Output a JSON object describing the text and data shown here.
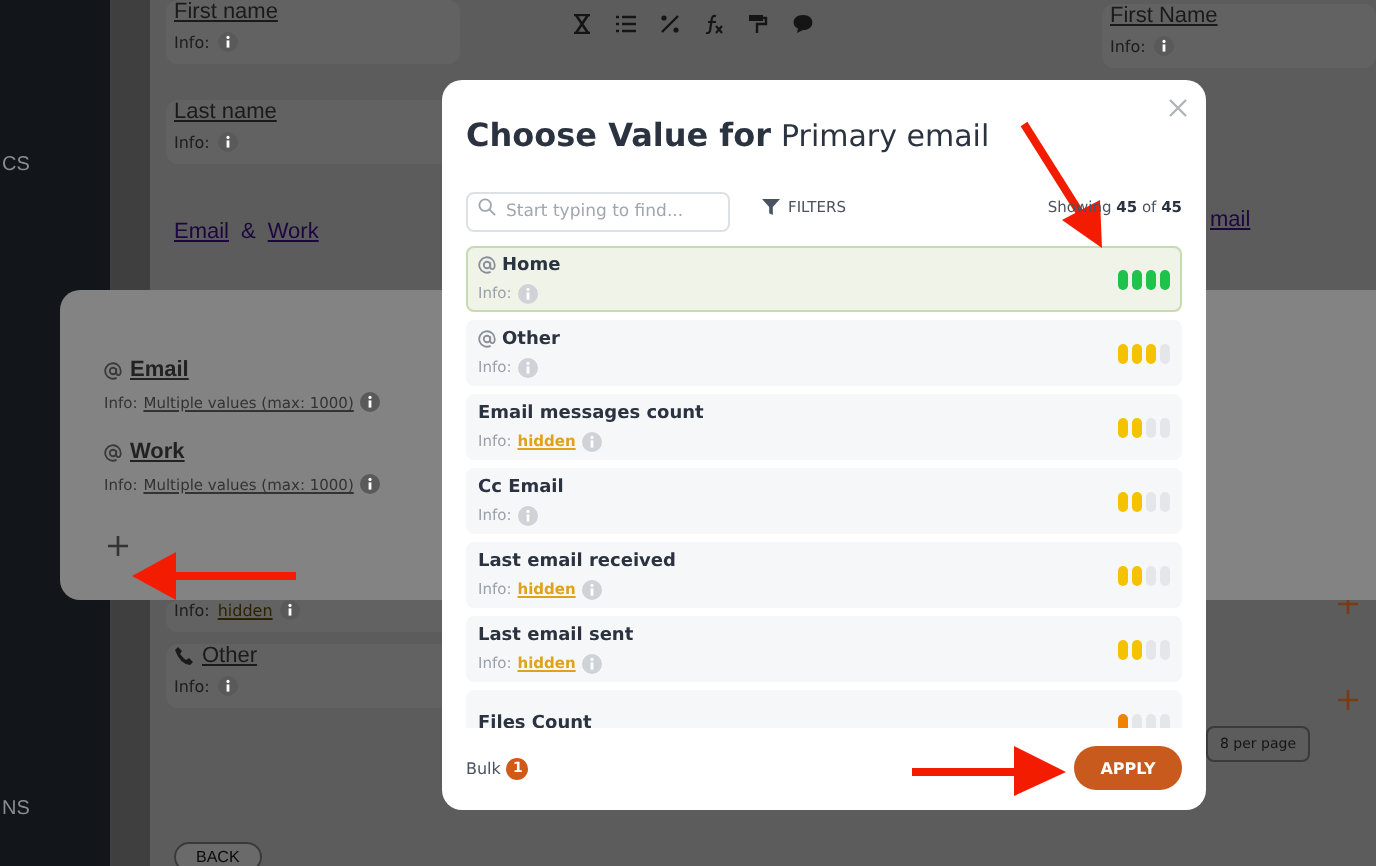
{
  "sidebar": {
    "items": [
      {
        "label": "CS"
      },
      {
        "label": "NS"
      }
    ]
  },
  "background": {
    "left_fields": [
      {
        "label": "First name",
        "info_label": "Info:"
      },
      {
        "label": "Last name",
        "info_label": "Info:"
      }
    ],
    "link_pair": {
      "first": "Email",
      "separator": "&",
      "second": "Work"
    },
    "lower_fields": [
      {
        "info_label": "Info:",
        "info_value": "hidden"
      },
      {
        "kind": "phone",
        "label": "Other",
        "info_label": "Info:"
      }
    ],
    "right_field": {
      "label": "First Name",
      "info_label": "Info:"
    },
    "right_link": "mail",
    "page_size": "8 per page",
    "back_button": "BACK"
  },
  "side_panel": {
    "items": [
      {
        "label": "Email",
        "info_label": "Info:",
        "info_value": "Multiple values (max: 1000)"
      },
      {
        "label": "Work",
        "info_label": "Info:",
        "info_value": "Multiple values (max: 1000)"
      }
    ]
  },
  "modal": {
    "title": "Choose Value for",
    "field_name": "Primary email",
    "search": {
      "placeholder": "Start typing to find..."
    },
    "filters": "FILTERS",
    "count": "Showing **45** of **45**",
    "items": [
      {
        "kind": "email",
        "name": "Home",
        "info_label": "Info:",
        "selected": true,
        "level": 1
      },
      {
        "kind": "email",
        "name": "Other",
        "info_label": "Info:",
        "selected": false,
        "level": 0.75
      },
      {
        "kind": "plain",
        "name": "Email messages count",
        "info_label": "Info:",
        "info_value": "hidden",
        "selected": false,
        "level": 0.5
      },
      {
        "kind": "plain",
        "name": "Cc Email",
        "info_label": "Info:",
        "selected": false,
        "level": 0.5
      },
      {
        "kind": "plain",
        "name": "Last email received",
        "info_label": "Info:",
        "info_value": "hidden",
        "selected": false,
        "level": 0.5
      },
      {
        "kind": "plain",
        "name": "Last email sent",
        "info_label": "Info:",
        "info_value": "hidden",
        "selected": false,
        "level": 0.5
      },
      {
        "kind": "plain",
        "name": "Files Count",
        "selected": false,
        "level": 0.25
      }
    ],
    "bulk": "Bulk",
    "bulk_count": "1",
    "apply": "APPLY"
  }
}
